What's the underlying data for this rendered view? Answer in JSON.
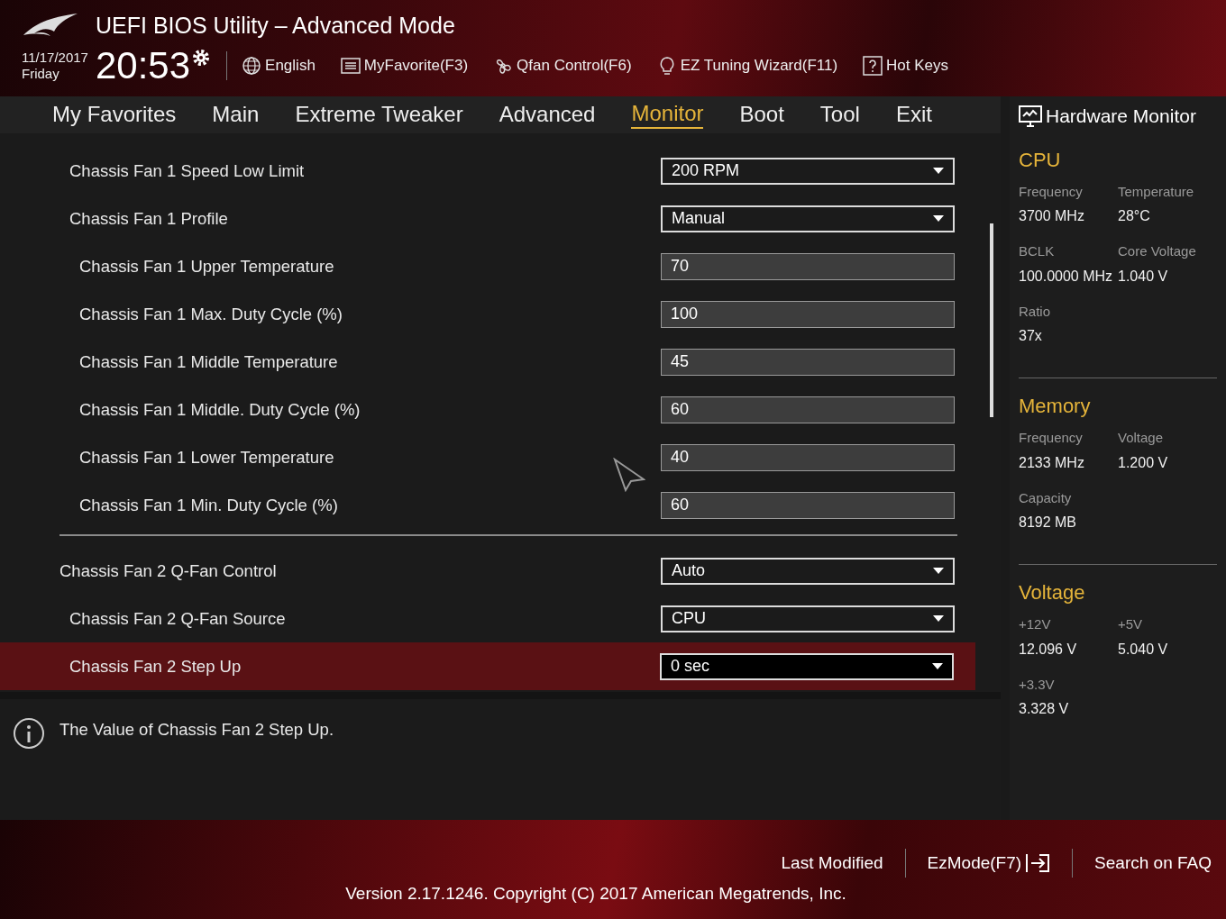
{
  "window": {
    "title": "UEFI BIOS Utility – Advanced Mode"
  },
  "header": {
    "date": "11/17/2017",
    "day": "Friday",
    "time": "20:53",
    "tools": [
      {
        "label": "English",
        "kind": "globe"
      },
      {
        "label": "MyFavorite(F3)",
        "kind": "favorites"
      },
      {
        "label": "Qfan Control(F6)",
        "kind": "fan"
      },
      {
        "label": "EZ Tuning Wizard(F11)",
        "kind": "bulb"
      },
      {
        "label": "Hot Keys",
        "kind": "help"
      }
    ]
  },
  "tabs": [
    {
      "label": "My Favorites",
      "selected": false
    },
    {
      "label": "Main",
      "selected": false
    },
    {
      "label": "Extreme Tweaker",
      "selected": false
    },
    {
      "label": "Advanced",
      "selected": false
    },
    {
      "label": "Monitor",
      "selected": true
    },
    {
      "label": "Boot",
      "selected": false
    },
    {
      "label": "Tool",
      "selected": false
    },
    {
      "label": "Exit",
      "selected": false
    }
  ],
  "sections": [
    {
      "partial": true,
      "rows": [
        {
          "label": "Chassis Fan 1 Speed Low Limit",
          "kind": "dropdown",
          "value": "200 RPM",
          "selected": false
        },
        {
          "label": "Chassis Fan 1 Profile",
          "kind": "dropdown",
          "value": "Manual",
          "selected": false,
          "children": [
            {
              "label": "Chassis Fan 1 Upper Temperature",
              "kind": "number",
              "value": "70",
              "selected": false
            },
            {
              "label": "Chassis Fan 1 Max. Duty Cycle (%)",
              "kind": "number",
              "value": "100",
              "selected": false
            },
            {
              "label": "Chassis Fan 1 Middle Temperature",
              "kind": "number",
              "value": "45",
              "selected": false
            },
            {
              "label": "Chassis Fan 1 Middle. Duty Cycle (%)",
              "kind": "number",
              "value": "60",
              "selected": false
            },
            {
              "label": "Chassis Fan 1 Lower Temperature",
              "kind": "number",
              "value": "40",
              "selected": false
            },
            {
              "label": "Chassis Fan 1 Min. Duty Cycle (%)",
              "kind": "number",
              "value": "60",
              "selected": false
            }
          ]
        }
      ]
    },
    {
      "partial": false,
      "rows": [
        {
          "label": "Chassis Fan 2 Q-Fan Control",
          "kind": "dropdown",
          "value": "Auto",
          "selected": false,
          "children": [
            {
              "label": "Chassis Fan 2 Q-Fan Source",
              "kind": "dropdown",
              "value": "CPU",
              "selected": false
            },
            {
              "label": "Chassis Fan 2 Step Up",
              "kind": "dropdown",
              "value": "0 sec",
              "selected": true
            }
          ]
        }
      ]
    }
  ],
  "help_text": "The Value of Chassis Fan 2 Step Up.",
  "hardware_monitor": {
    "title": "Hardware Monitor",
    "groups": [
      {
        "title": "CPU",
        "readings": [
          {
            "label": "Frequency",
            "value": "3700 MHz"
          },
          {
            "label": "Temperature",
            "value": "28°C"
          },
          {
            "label": "BCLK",
            "value": "100.0000 MHz"
          },
          {
            "label": "Core Voltage",
            "value": "1.040 V"
          },
          {
            "label": "Ratio",
            "value": "37x"
          }
        ]
      },
      {
        "title": "Memory",
        "readings": [
          {
            "label": "Frequency",
            "value": "2133 MHz"
          },
          {
            "label": "Voltage",
            "value": "1.200 V"
          },
          {
            "label": "Capacity",
            "value": "8192 MB"
          }
        ]
      },
      {
        "title": "Voltage",
        "readings": [
          {
            "label": "+12V",
            "value": "12.096 V"
          },
          {
            "label": "+5V",
            "value": "5.040 V"
          },
          {
            "label": "+3.3V",
            "value": "3.328 V"
          }
        ]
      }
    ]
  },
  "footer": {
    "links": [
      {
        "label": "Last Modified",
        "kind": "plain"
      },
      {
        "label": "EzMode(F7)",
        "kind": "exit"
      },
      {
        "label": "Search on FAQ",
        "kind": "plain"
      }
    ],
    "version": "Version 2.17.1246. Copyright (C) 2017 American Megatrends, Inc."
  }
}
